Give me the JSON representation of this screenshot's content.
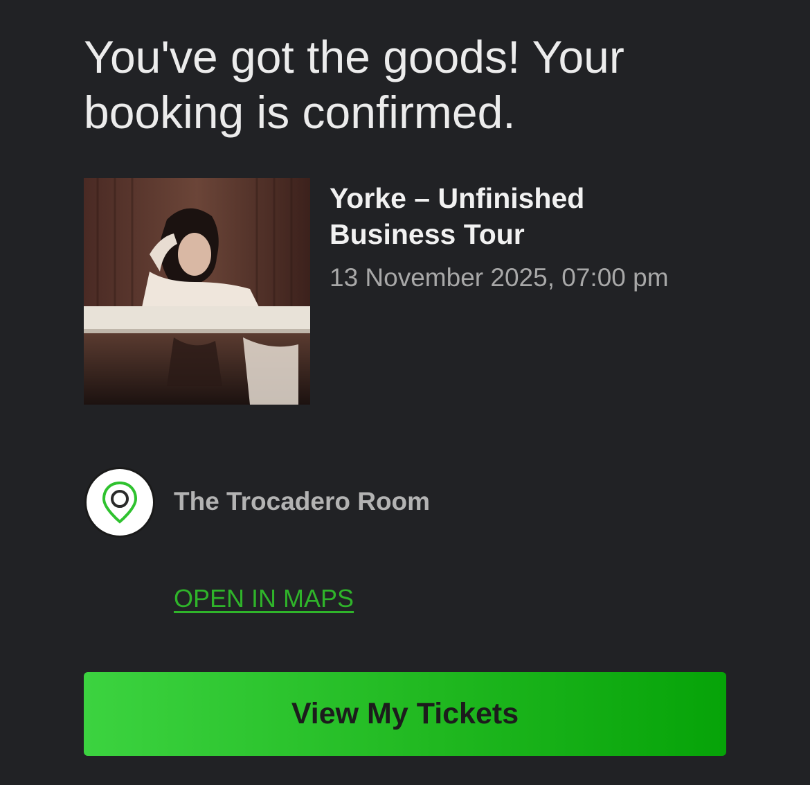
{
  "confirmation": {
    "headline": "You've got the goods! Your booking is confirmed."
  },
  "event": {
    "title": "Yorke – Unfinished Business Tour",
    "datetime": "13 November 2025, 07:00 pm",
    "image_icon": "event-artist-photo"
  },
  "venue": {
    "name": "The Trocadero Room",
    "icon": "map-pin-icon",
    "maps_link_label": "OPEN IN MAPS"
  },
  "actions": {
    "view_tickets_label": "View My Tickets"
  },
  "colors": {
    "background": "#212225",
    "accent_green": "#22b522",
    "link_green": "#2fb42a",
    "muted_text": "#a8a8a8"
  }
}
